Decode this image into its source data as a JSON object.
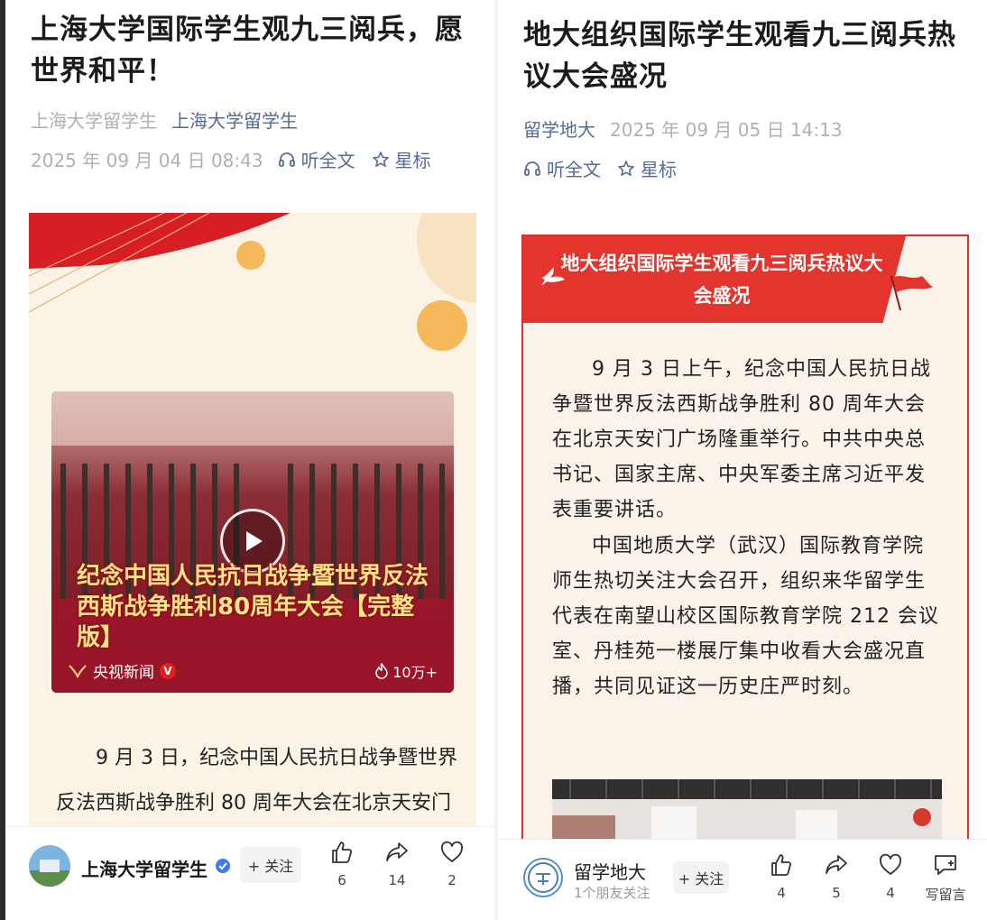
{
  "left": {
    "title": "上海大学国际学生观九三阅兵，愿世界和平！",
    "meta_author": "上海大学留学生",
    "meta_account": "上海大学留学生",
    "datetime": "2025 年 09 月 04 日 08:43",
    "listen_label": "听全文",
    "star_label": "星标",
    "video": {
      "caption": "纪念中国人民抗日战争暨世界反法西斯战争胜利80周年大会【完整版】",
      "source": "央视新闻",
      "views": "10万+"
    },
    "paragraph": "9 月 3 日，纪念中国人民抗日战争暨世界反法西斯战争胜利 80 周年大会在北京天安门广场隆重举行，上海大学国际学",
    "bottom": {
      "account_name": "上海大学留学生",
      "follow_label": "+ 关注",
      "likes": "6",
      "shares": "14",
      "favorites": "2"
    }
  },
  "right": {
    "title": "地大组织国际学生观看九三阅兵热议大会盛况",
    "meta_account": "留学地大",
    "datetime": "2025 年 09 月 05 日 14:13",
    "listen_label": "听全文",
    "star_label": "星标",
    "banner_title": "地大组织国际学生观看九三阅兵热议大会盛况",
    "paragraph1": "9 月 3 日上午，纪念中国人民抗日战争暨世界反法西斯战争胜利 80 周年大会在北京天安门广场隆重举行。中共中央总书记、国家主席、中央军委主席习近平发表重要讲话。",
    "paragraph2": "中国地质大学（武汉）国际教育学院师生热切关注大会召开，组织来华留学生代表在南望山校区国际教育学院 212 会议室、丹桂苑一楼展厅集中收看大会盛况直播，共同见证这一历史庄严时刻。",
    "bottom": {
      "account_name": "留学地大",
      "account_sub": "1个朋友关注",
      "follow_label": "+ 关注",
      "likes": "4",
      "shares": "5",
      "favorites": "4",
      "comment_label": "写留言"
    }
  },
  "colors": {
    "link": "#576b95",
    "meta_gray": "#b0b0b0",
    "banner_red": "#e3352d",
    "poster_cream": "#fbf3e6"
  },
  "icons": [
    "headphones-icon",
    "star-icon",
    "play-icon",
    "fire-icon",
    "verified-icon",
    "thumbs-up-icon",
    "share-icon",
    "heart-icon",
    "comment-icon",
    "dove-icon",
    "flag-icon"
  ]
}
